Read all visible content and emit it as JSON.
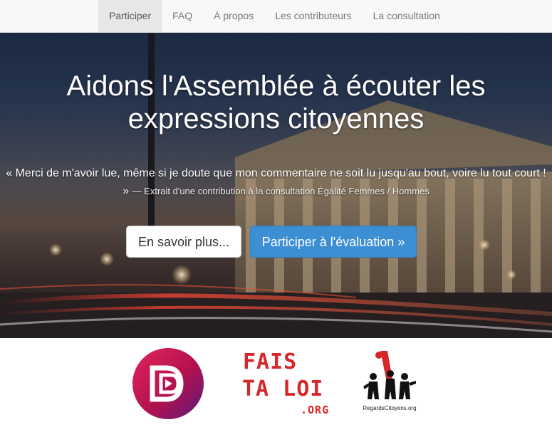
{
  "nav": {
    "items": [
      {
        "label": "Participer",
        "active": true
      },
      {
        "label": "FAQ",
        "active": false
      },
      {
        "label": "À propos",
        "active": false
      },
      {
        "label": "Les contributeurs",
        "active": false
      },
      {
        "label": "La consultation",
        "active": false
      }
    ]
  },
  "hero": {
    "title_line1": "Aidons l'Assemblée à écouter les",
    "title_line2": "expressions citoyennes",
    "quote": "« Merci de m'avoir lue, même si je doute que mon commentaire ne soit lu jusqu'au bout, voire lu tout court ! »",
    "quote_source": "— Extrait d'une contribution à la consultation Égalité Femmes / Hommes",
    "buttons": {
      "learn_more": "En savoir plus...",
      "participate": "Participer à l'évaluation »"
    },
    "background_image": "Assemblée nationale building at night with light trails"
  },
  "logos": {
    "democratie_ouverte": {
      "icon": "democratie-ouverte-logo",
      "color": "#c2185b"
    },
    "fais_ta_loi": {
      "line1": "FAIS",
      "line2": "TA LOI",
      "line3": ".ORG",
      "color": "#d6272a"
    },
    "regards_citoyens": {
      "caption": "RegardsCitoyens.org",
      "icon": "regards-citoyens-logo"
    }
  },
  "colors": {
    "navbar_bg": "#f8f8f8",
    "nav_active_bg": "#e7e7e7",
    "primary_button": "#3d8fd4",
    "logo_red": "#d6272a"
  }
}
